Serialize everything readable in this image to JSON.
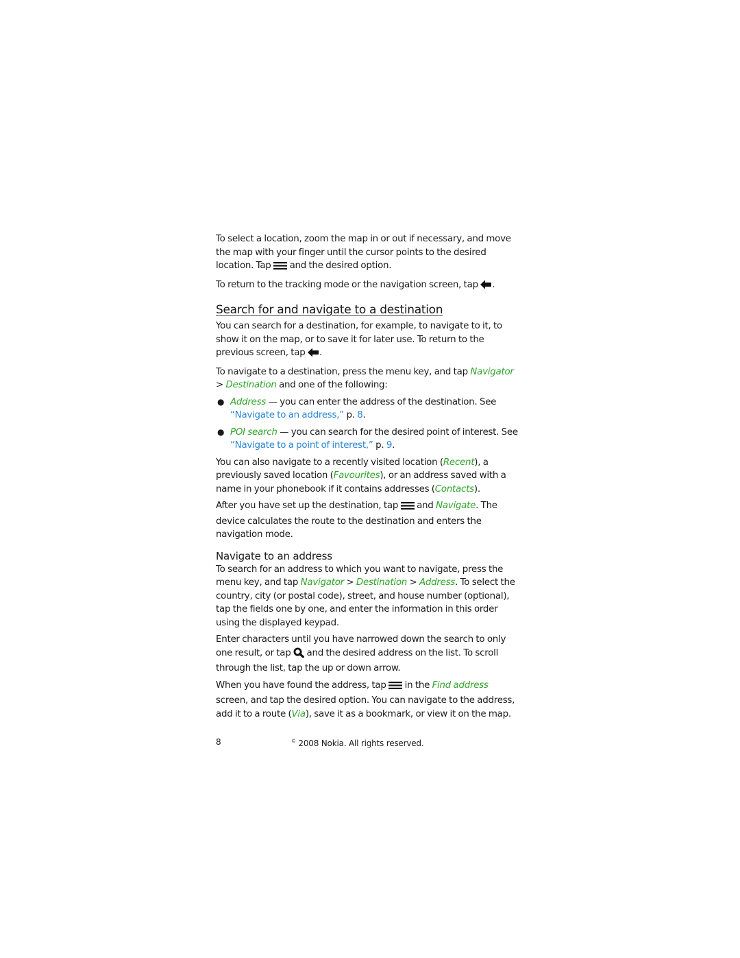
{
  "colors": {
    "menu_item_green": "#2fa32a",
    "cross_reference_blue": "#2a86d6",
    "body_text": "#1a1a1a"
  },
  "intro": {
    "p1_a": "To select a location, zoom the map in or out if necessary, and move the map with your finger until the cursor points to the desired location. Tap ",
    "p1_icon": "options-menu-icon",
    "p1_b": " and the desired option.",
    "p2_a": "To return to the tracking mode or the navigation screen, tap ",
    "p2_icon": "back-arrow-icon",
    "p2_b": "."
  },
  "section": {
    "title": "Search for and navigate to a destination",
    "p1_a": "You can search for a destination, for example, to navigate to it, to show it on the map, or to save it for later use. To return to the previous screen, tap ",
    "p1_icon": "back-arrow-icon",
    "p1_b": ".",
    "p2_a": "To navigate to a destination, press the menu key, and tap ",
    "p2_navigator": "Navigator",
    "p2_sep": " > ",
    "p2_destination": "Destination",
    "p2_b": " and one of the following:",
    "bullets": [
      {
        "term": "Address",
        "text": " — you can enter the address of the destination. See ",
        "ref": "“Navigate to an address,”",
        "page_prefix": " p. ",
        "page": "8",
        "end": "."
      },
      {
        "term": "POI search",
        "text": " — you can search for the desired point of interest. See ",
        "ref": "“Navigate to a point of interest,”",
        "page_prefix": " p. ",
        "page": "9",
        "end": "."
      }
    ],
    "p3_a": "You can also navigate to a recently visited location (",
    "p3_recent": "Recent",
    "p3_b": "), a previously saved location (",
    "p3_favourites": "Favourites",
    "p3_c": "), or an address saved with a name in your phonebook if it contains addresses (",
    "p3_contacts": "Contacts",
    "p3_d": ").",
    "p4_a": "After you have set up the destination, tap ",
    "p4_icon": "options-menu-icon",
    "p4_b": " and ",
    "p4_navigate": "Navigate",
    "p4_c": ". The device calculates the route to the destination and enters the navigation mode."
  },
  "subsection": {
    "title": "Navigate to an address",
    "p1_a": "To search for an address to which you want to navigate, press the menu key, and tap ",
    "p1_navigator": "Navigator",
    "p1_sep1": " > ",
    "p1_destination": "Destination",
    "p1_sep2": " > ",
    "p1_address": "Address",
    "p1_b": ". To select the country, city (or postal code), street, and house number (optional), tap the fields one by one, and enter the information in this order using the displayed keypad.",
    "p2_a": "Enter characters until you have narrowed down the search to only one result, or tap ",
    "p2_icon": "search-icon",
    "p2_b": " and the desired address on the list. To scroll through the list, tap the up or down arrow.",
    "p3_a": "When you have found the address, tap ",
    "p3_icon": "options-menu-icon",
    "p3_b": " in the ",
    "p3_find_address": "Find address",
    "p3_c": " screen, and tap the desired option. You can navigate to the address, add it to a route (",
    "p3_via": "Via",
    "p3_d": "), save it as a bookmark, or view it on the map."
  },
  "footer": {
    "page_number": "8",
    "copyright_symbol": "©",
    "copyright_text": " 2008 Nokia. All rights reserved."
  }
}
